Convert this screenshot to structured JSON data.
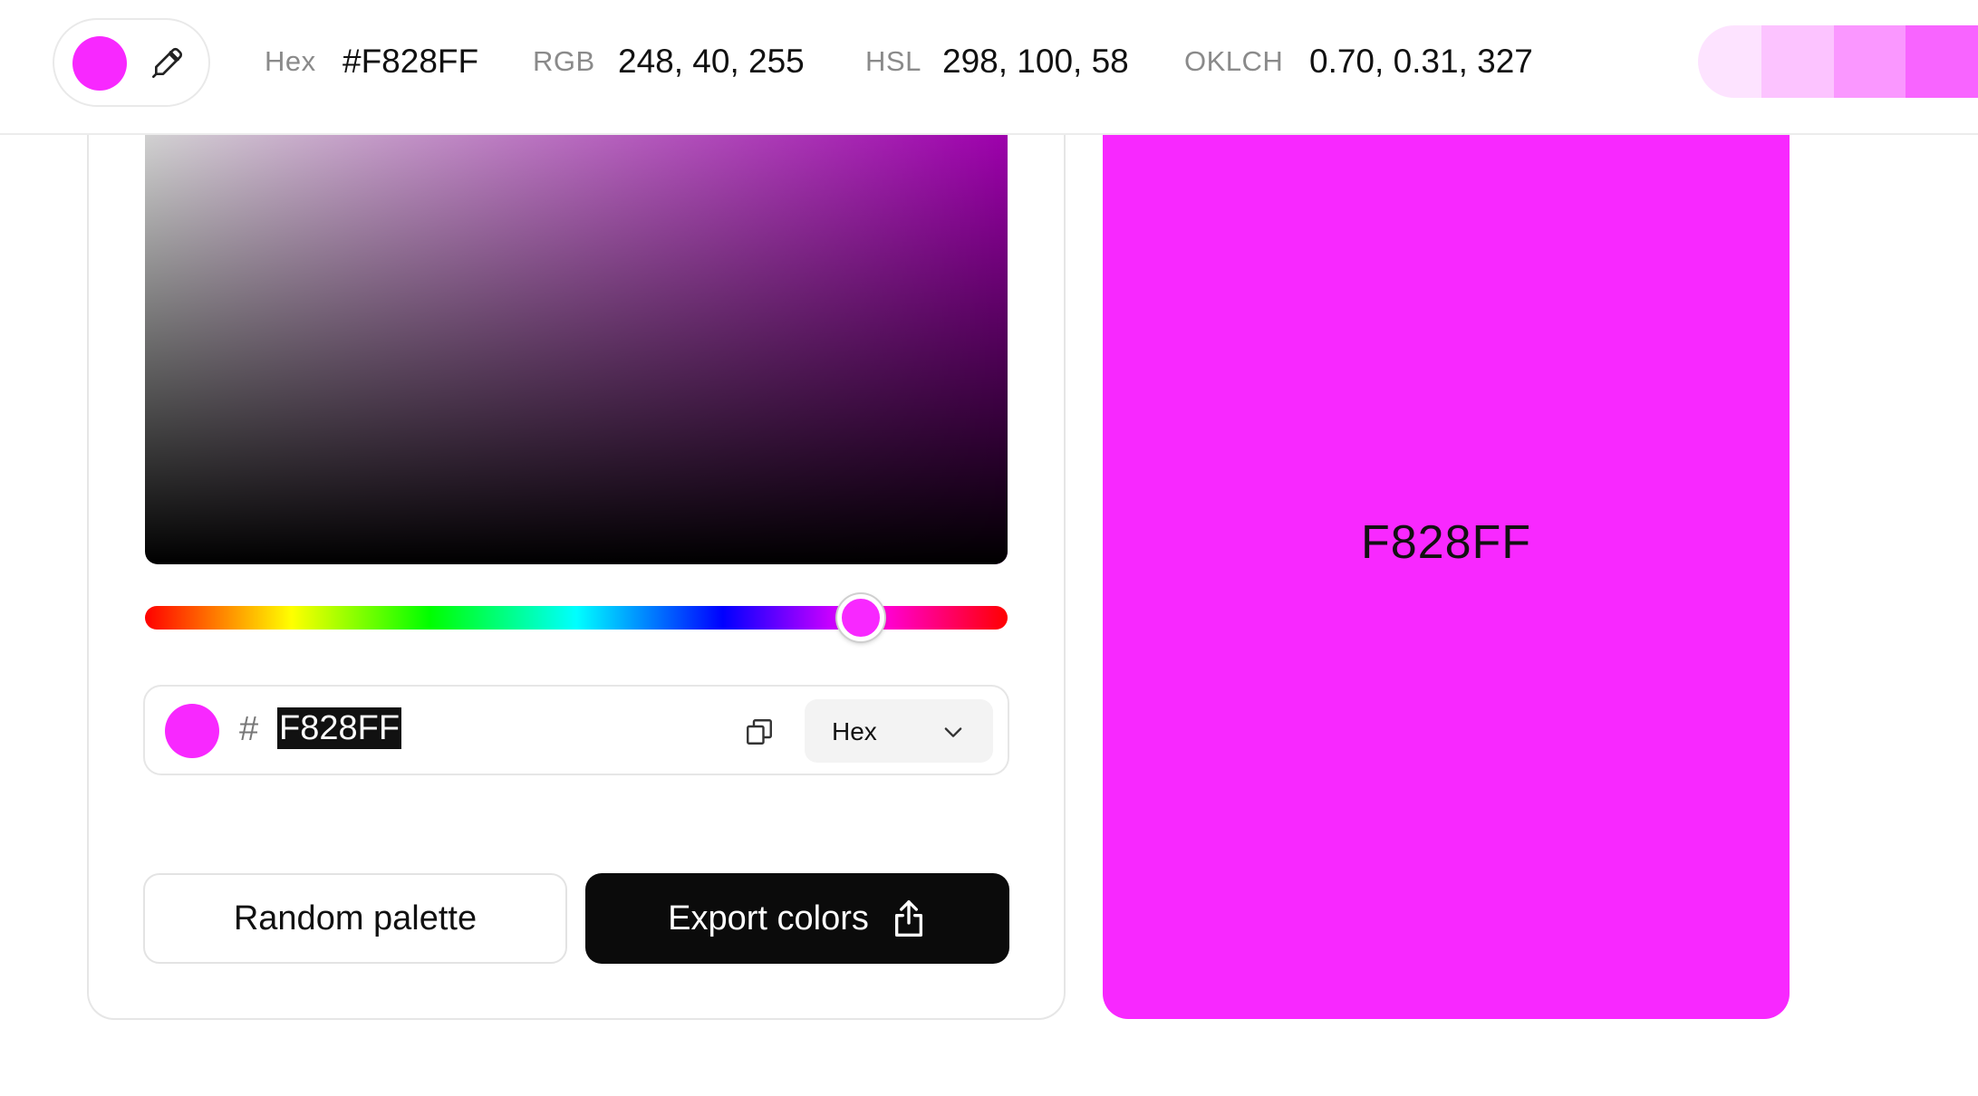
{
  "color": {
    "accent": "#F828FF",
    "shades": [
      "#FDE3FF",
      "#FCC3FF",
      "#FA97FF",
      "#F864FF"
    ]
  },
  "topbar": {
    "hex_label": "Hex",
    "hex_value": "#F828FF",
    "rgb_label": "RGB",
    "rgb_value": "248, 40, 255",
    "hsl_label": "HSL",
    "hsl_value": "298, 100, 58",
    "oklch_label": "OKLCH",
    "oklch_value": "0.70, 0.31, 327",
    "icons": [
      "color-swatch",
      "eyedropper-icon"
    ]
  },
  "picker": {
    "hue_value": 298,
    "input": {
      "prefix": "#",
      "value": "F828FF"
    },
    "format_select": {
      "selected": "Hex"
    },
    "icons": [
      "copy-icon",
      "chevron-down-icon"
    ]
  },
  "actions": {
    "random_label": "Random palette",
    "export_label": "Export colors",
    "export_icon": "share-icon"
  },
  "preview": {
    "label": "F828FF"
  }
}
